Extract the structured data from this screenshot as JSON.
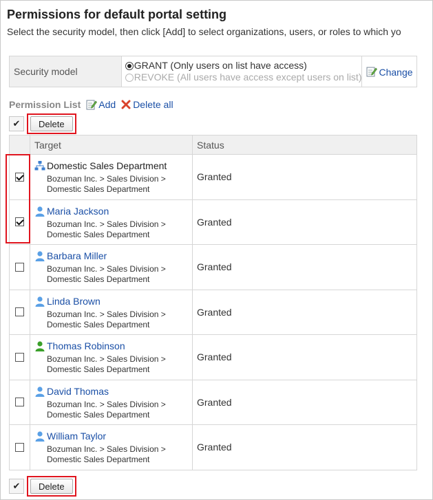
{
  "page": {
    "title": "Permissions for default portal setting",
    "subtitle": "Select the security model, then click [Add] to select organizations, users, or roles to which yo"
  },
  "security": {
    "label": "Security model",
    "grant_label": "GRANT (Only users on list have access)",
    "revoke_label": "REVOKE (All users have access except users on list)",
    "selected": "GRANT",
    "change_label": "Change"
  },
  "permission_list": {
    "title": "Permission List",
    "add_label": "Add",
    "delete_all_label": "Delete all"
  },
  "toolbar": {
    "check_all_glyph": "✔",
    "delete_label": "Delete"
  },
  "table": {
    "headers": {
      "target": "Target",
      "status": "Status"
    },
    "rows": [
      {
        "checked": true,
        "type": "organization",
        "name": "Domestic Sales Department",
        "path1": "Bozuman Inc. > Sales Division >",
        "path2": "Domestic Sales Department",
        "status": "Granted"
      },
      {
        "checked": true,
        "type": "user",
        "name": "Maria Jackson",
        "path1": "Bozuman Inc. > Sales Division >",
        "path2": "Domestic Sales Department",
        "status": "Granted"
      },
      {
        "checked": false,
        "type": "user",
        "name": "Barbara Miller",
        "path1": "Bozuman Inc. > Sales Division >",
        "path2": "Domestic Sales Department",
        "status": "Granted"
      },
      {
        "checked": false,
        "type": "user",
        "name": "Linda Brown",
        "path1": "Bozuman Inc. > Sales Division >",
        "path2": "Domestic Sales Department",
        "status": "Granted"
      },
      {
        "checked": false,
        "type": "user-green",
        "name": "Thomas Robinson",
        "path1": "Bozuman Inc. > Sales Division >",
        "path2": "Domestic Sales Department",
        "status": "Granted"
      },
      {
        "checked": false,
        "type": "user",
        "name": "David Thomas",
        "path1": "Bozuman Inc. > Sales Division >",
        "path2": "Domestic Sales Department",
        "status": "Granted"
      },
      {
        "checked": false,
        "type": "user",
        "name": "William Taylor",
        "path1": "Bozuman Inc. > Sales Division >",
        "path2": "Domestic Sales Department",
        "status": "Granted"
      }
    ]
  },
  "colors": {
    "link": "#1a4fa6",
    "highlight": "#e0141e",
    "user_icon": "#5aa0e6",
    "user_icon_green": "#3aa02a",
    "org_icon": "#3d7fd0"
  }
}
